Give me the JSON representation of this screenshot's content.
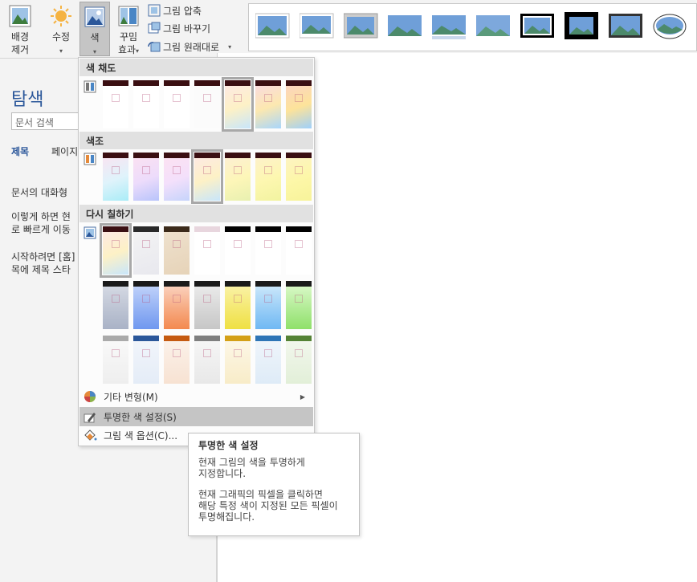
{
  "ribbon": {
    "remove_bg": {
      "line1": "배경",
      "line2": "제거"
    },
    "corrections": {
      "label": "수정"
    },
    "color": {
      "label": "색"
    },
    "artistic": {
      "line1": "꾸밈",
      "line2": "효과"
    },
    "compress": "그림 압축",
    "change": "그림 바꾸기",
    "reset": "그림 원래대로"
  },
  "nav": {
    "title": "탐색",
    "search_placeholder": "문서 검색",
    "tabs": [
      "제목",
      "페이지"
    ],
    "text1": "문서의 대화형 ",
    "text2a": "이렇게 하면 현",
    "text2b": "로 빠르게 이동",
    "text3a": "시작하려면 [홈]",
    "text3b": "목에 제목 스타"
  },
  "dropdown": {
    "saturation_header": "색 채도",
    "tone_header": "색조",
    "recolor_header": "다시 칠하기",
    "more_variations": "기타 변형(M)",
    "set_transparent": "투명한 색 설정(S)",
    "color_options": "그림 색 옵션(C)..."
  },
  "tooltip": {
    "title": "투명한 색 설정",
    "line1": "현재 그림의 색을 투명하게",
    "line2": "지정합니다.",
    "line3": "현재 그래픽의 픽셀을 클릭하면",
    "line4": "해당 특정 색이 지정된 모든 픽셀이",
    "line5": "투명해집니다."
  },
  "colors": {
    "accent_blue": "#2b579a",
    "hover_gray": "#c5c5c5"
  }
}
